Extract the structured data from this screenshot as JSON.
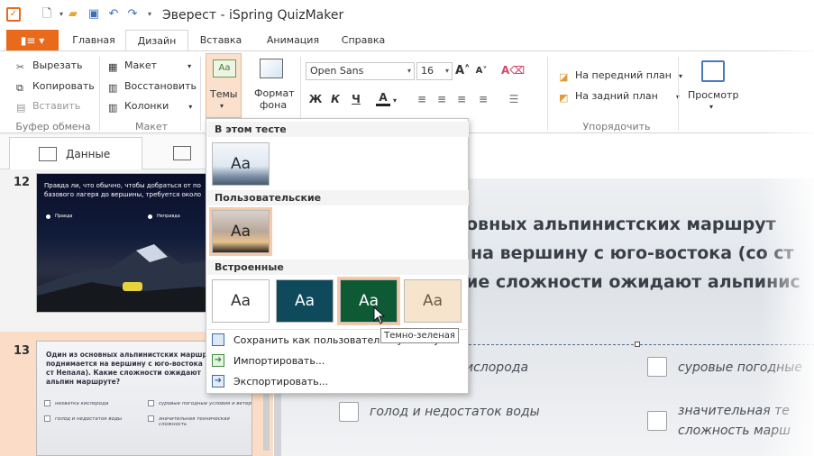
{
  "title_bar": {
    "title": "Эверест - iSpring QuizMaker",
    "app_icon": "quizmaker-logo"
  },
  "tabs": [
    {
      "label": "Главная"
    },
    {
      "label": "Дизайн"
    },
    {
      "label": "Вставка"
    },
    {
      "label": "Анимация"
    },
    {
      "label": "Справка"
    }
  ],
  "clipboard": {
    "cut": "Вырезать",
    "copy": "Копировать",
    "paste": "Вставить",
    "group": "Буфер обмена"
  },
  "layout": {
    "layout": "Макет",
    "restore": "Восстановить",
    "columns": "Колонки",
    "group": "Макет"
  },
  "themes": {
    "themes_label": "Темы",
    "format_bg_line1": "Формат",
    "format_bg_line2": "фона"
  },
  "font": {
    "family": "Open Sans",
    "size": "16",
    "bold": "Ж",
    "italic": "К",
    "underline": "Ч",
    "color": "А"
  },
  "arrange": {
    "front": "На передний план",
    "back": "На задний план",
    "group": "Упорядочить"
  },
  "preview": {
    "label": "Просмотр"
  },
  "left_panel": {
    "data_tab": "Данные"
  },
  "slides": [
    {
      "number": "12",
      "question": "Правда ли, что обычно, чтобы добраться от по базового лагеря до вершины, требуется около",
      "opt1": "Правда",
      "opt2": "Неправда"
    },
    {
      "number": "13",
      "question": "Один из основных альпинистских маршрутов поднимается на вершину с юго-востока (со ст Непала). Какие сложности ожидают альпин маршруте?",
      "o1": "нехватка кислорода",
      "o2": "суровые погодные условия и ветер",
      "o3": "голод и недостаток воды",
      "o4": "значительная техническая сложность"
    }
  ],
  "main": {
    "line1": "овных альпинистских маршрут",
    "line2": "на вершину с юго-востока (со ст",
    "line2_grey": "(со ст",
    "line3": "ие сложности ожидают альпинис",
    "opt1": "ислорода",
    "opt2": "суровые погодные",
    "opt3": "голод и недостаток воды",
    "opt4a": "значительная те",
    "opt4b": "сложность марш"
  },
  "dropdown": {
    "in_this_test": "В этом тесте",
    "custom": "Пользовательские",
    "builtin": "Встроенные",
    "tile_label": "Aa",
    "save_custom": "Сохранить как пользовательскую тему...",
    "import": "Импортировать...",
    "export": "Экспортировать...",
    "tooltip": "Темно-зеленая"
  },
  "colors": {
    "accent": "#e86a1a",
    "dark_teal": "#0f4a5c",
    "dark_green": "#0e5a34",
    "beige": "#f6e4cc"
  }
}
